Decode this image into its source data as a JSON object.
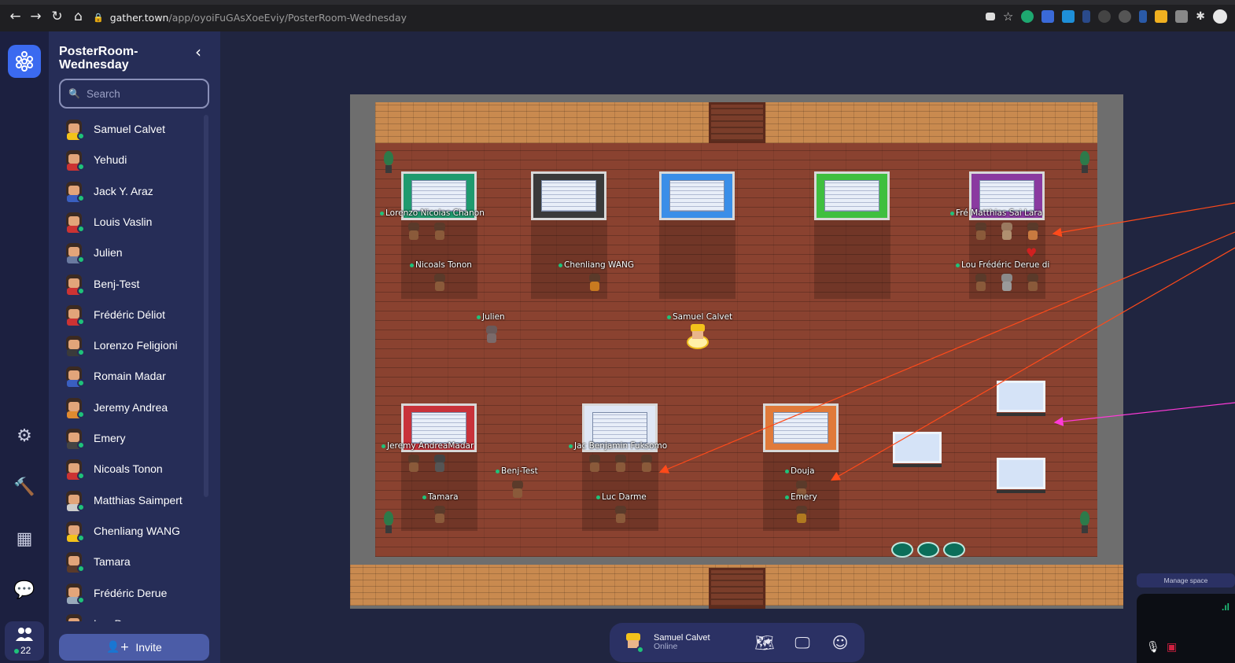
{
  "browser": {
    "url_host": "gather.town",
    "url_path": "/app/oyoiFuGAsXoeEviy/PosterRoom-Wednesday"
  },
  "sidebar": {
    "space_title": "PosterRoom-Wednesday",
    "search_placeholder": "Search",
    "users": [
      {
        "name": "Samuel Calvet",
        "color": "#f3c21b"
      },
      {
        "name": "Yehudi",
        "color": "#c33"
      },
      {
        "name": "Jack Y. Araz",
        "color": "#3a5fc0"
      },
      {
        "name": "Louis Vaslin",
        "color": "#c33"
      },
      {
        "name": "Julien",
        "color": "#6a7aa0"
      },
      {
        "name": "Benj-Test",
        "color": "#c33"
      },
      {
        "name": "Frédéric Déliot",
        "color": "#c33"
      },
      {
        "name": "Lorenzo Feligioni",
        "color": "#3a3a3a"
      },
      {
        "name": "Romain Madar",
        "color": "#3a5fc0"
      },
      {
        "name": "Jeremy Andrea",
        "color": "#e08a30"
      },
      {
        "name": "Emery",
        "color": "#444"
      },
      {
        "name": "Nicoals Tonon",
        "color": "#c33"
      },
      {
        "name": "Matthias Saimpert",
        "color": "#ccc"
      },
      {
        "name": "Chenliang WANG",
        "color": "#f3c21b"
      },
      {
        "name": "Tamara",
        "color": "#5a3a2a"
      },
      {
        "name": "Frédéric Derue",
        "color": "#9ab"
      },
      {
        "name": "Luc Darme",
        "color": "#c33"
      }
    ],
    "invite_label": "Invite"
  },
  "rail": {
    "participant_count": "22",
    "icons": [
      "settings-icon",
      "build-tool-icon",
      "calendar-icon",
      "chat-icon",
      "participants-icon"
    ]
  },
  "map": {
    "name_tags": {
      "poster1": "Lorenzo Nicolas Chanon",
      "poster1_b": "Nicoals Tonon",
      "poster2_b": "Chenliang WANG",
      "poster5": "Fré Matthias Sai Lara",
      "poster5_b": "Lou Frédéric Derue di",
      "julien": "Julien",
      "samuel": "Samuel Calvet",
      "poster6": "Jeremy AndreaMadar",
      "benj": "Benj-Test",
      "tamara": "Tamara",
      "poster7": "Jac Benjamin Fuksomo",
      "luc": "Luc Darme",
      "douja": "Douja",
      "emery": "Emery"
    },
    "poster_colors": [
      "#1f9a6e",
      "#3a3a3a",
      "#3a8ee8",
      "#3fbf3f",
      "#8a3aa0",
      "#c8323a",
      "#dfe7f5",
      "#e07a3a"
    ]
  },
  "bottom_bar": {
    "user_name": "Samuel Calvet",
    "status": "Online",
    "icons": [
      "map-icon",
      "screen-share-icon",
      "emoji-icon"
    ]
  },
  "right_panel": {
    "manage_label": "Manage space"
  }
}
